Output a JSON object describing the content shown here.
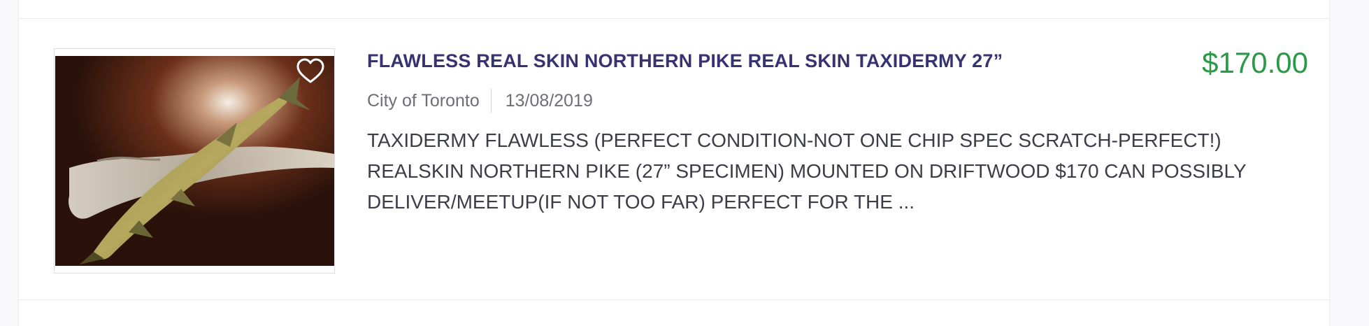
{
  "listing": {
    "title": "FLAWLESS REAL SKIN NORTHERN PIKE REAL SKIN TAXIDERMY 27”",
    "price": "$170.00",
    "location": "City of Toronto",
    "date": "13/08/2019",
    "description": "TAXIDERMY FLAWLESS (PERFECT CONDITION-NOT ONE CHIP SPEC SCRATCH-PERFECT!) REALSKIN NORTHERN PIKE (27” SPECIMEN) MOUNTED ON DRIFTWOOD $170 CAN POSSIBLY DELIVER/MEETUP(IF NOT TOO FAR) PERFECT FOR THE ...",
    "favorite_icon": "heart-outline-icon"
  },
  "colors": {
    "title": "#373373",
    "price": "#2b9a48",
    "meta": "#6e6e78",
    "description": "#3d3d48"
  }
}
